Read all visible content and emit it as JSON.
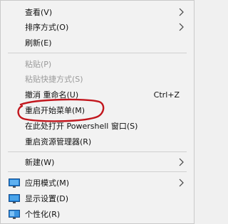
{
  "menu": {
    "view": "查看(V)",
    "sort": "排序方式(O)",
    "refresh": "刷新(E)",
    "paste": "粘贴(P)",
    "paste_shortcut": "粘贴快捷方式(S)",
    "undo_rename": "撤消 重命名(U)",
    "undo_shortcut": "Ctrl+Z",
    "restart_start_menu": "重启开始菜单(M)",
    "open_powershell": "在此处打开 Powershell 窗口(S)",
    "restart_explorer": "重启资源管理器(R)",
    "new": "新建(W)",
    "app_mode": "应用模式(M)",
    "display_settings": "显示设置(D)",
    "personalize": "个性化(R)"
  },
  "icons": {
    "chevron": "chevron-right-icon",
    "app_mode": "app-mode-icon",
    "display_settings": "display-icon",
    "personalize": "personalize-icon"
  },
  "colors": {
    "highlight_ring": "#c2161d"
  }
}
